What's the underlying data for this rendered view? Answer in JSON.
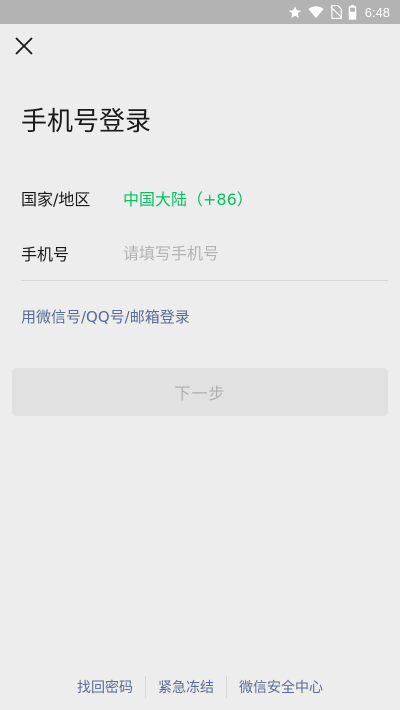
{
  "status_bar": {
    "time": "6:48",
    "icons": [
      "star-icon",
      "wifi-icon",
      "no-sim-icon",
      "battery-icon"
    ]
  },
  "header": {
    "close_icon": "close-icon"
  },
  "page": {
    "title": "手机号登录"
  },
  "form": {
    "region_label": "国家/地区",
    "region_value": "中国大陆（+86）",
    "phone_label": "手机号",
    "phone_value": "",
    "phone_placeholder": "请填写手机号"
  },
  "alt_login": {
    "label": "用微信号/QQ号/邮箱登录"
  },
  "next_button": {
    "label": "下一步"
  },
  "footer": {
    "links": [
      "找回密码",
      "紧急冻结",
      "微信安全中心"
    ]
  },
  "colors": {
    "accent_green": "#07c160",
    "link_blue": "#576b95",
    "background": "#ededed",
    "disabled_button": "#e1e1e1"
  }
}
